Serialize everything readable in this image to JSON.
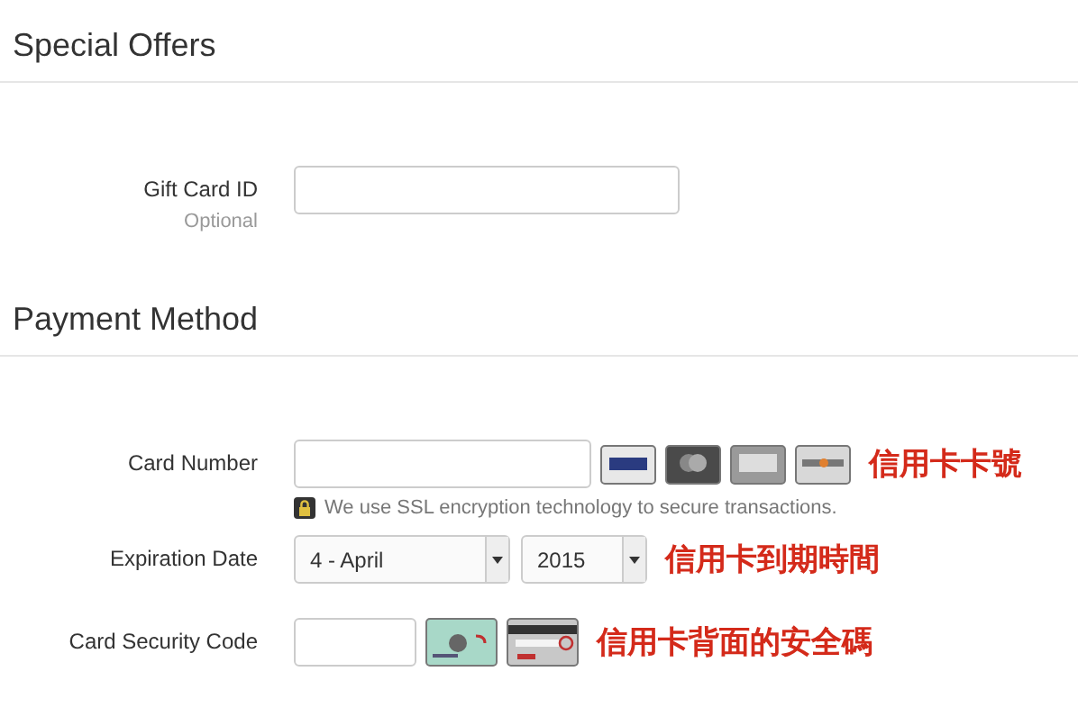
{
  "sections": [
    {
      "title": "Special Offers",
      "rows": [
        {
          "kind": "text",
          "label": "Gift Card ID",
          "hint": "Optional"
        }
      ]
    },
    {
      "title": "Payment Method",
      "rows": [
        {
          "kind": "card",
          "label": "Card Number",
          "note": "We use SSL encryption technology to secure transactions.",
          "annotation": "信用卡卡號"
        },
        {
          "kind": "expiry",
          "label": "Expiration Date",
          "month": "4 - April",
          "year": "2015",
          "annotation": "信用卡到期時間"
        },
        {
          "kind": "cvc",
          "label": "Card Security Code",
          "annotation": "信用卡背面的安全碼"
        }
      ]
    }
  ]
}
